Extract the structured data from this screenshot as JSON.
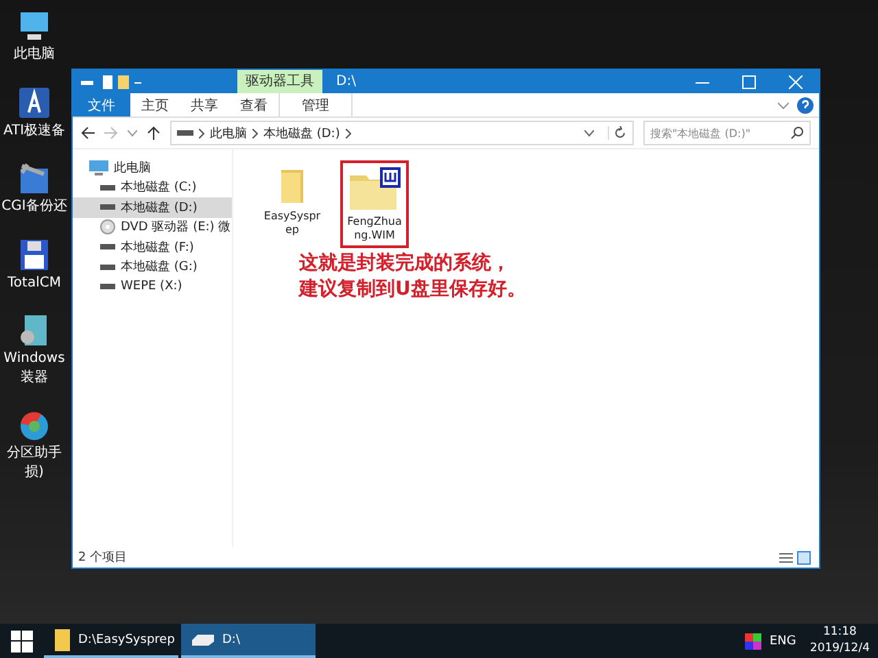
{
  "desktop_icons": [
    {
      "kind": "pc",
      "label": "此电脑"
    },
    {
      "kind": "backup",
      "label": "ATI极速备"
    },
    {
      "kind": "tool",
      "label": "CGI备份还"
    },
    {
      "kind": "floppy",
      "label": "TotalCM"
    },
    {
      "kind": "installer",
      "label": "Windows",
      "label_2": "装器"
    },
    {
      "kind": "partition",
      "label": "分区助手",
      "label_2": "损)"
    }
  ],
  "window": {
    "title": "D:\\",
    "context_tab": "驱动器工具",
    "ribbon_tabs": [
      {
        "label": "文件",
        "kind": "file",
        "selected": false
      },
      {
        "label": "主页",
        "kind": "tab",
        "selected": false
      },
      {
        "label": "共享",
        "kind": "tab",
        "selected": false
      },
      {
        "label": "查看",
        "kind": "tab",
        "selected": false
      },
      {
        "label": "管理",
        "kind": "context",
        "selected": false
      }
    ],
    "breadcrumbs": [
      "此电脑",
      "本地磁盘 (D:)"
    ],
    "search": {
      "placeholder": "搜索\"本地磁盘 (D:)\""
    },
    "sidebar": {
      "items": [
        {
          "label": "此电脑",
          "kind": "pc",
          "selected": false,
          "children": [
            {
              "label": "本地磁盘 (C:)",
              "kind": "drive",
              "selected": false
            },
            {
              "label": "本地磁盘 (D:)",
              "kind": "drive",
              "selected": true
            },
            {
              "label": "DVD 驱动器 (E:) 微",
              "kind": "dvd",
              "selected": false
            },
            {
              "label": "本地磁盘 (F:)",
              "kind": "drive",
              "selected": false
            },
            {
              "label": "本地磁盘 (G:)",
              "kind": "drive",
              "selected": false
            },
            {
              "label": "WEPE (X:)",
              "kind": "drive",
              "selected": false
            }
          ]
        }
      ]
    },
    "files": [
      {
        "name": "EasySysprep",
        "kind": "folder",
        "highlighted": false
      },
      {
        "name": "FengZhuang.WIM",
        "kind": "wim",
        "highlighted": true
      }
    ],
    "annotation": [
      "这就是封装完成的系统，",
      "建议复制到U盘里保存好。"
    ],
    "status_bar": "2 个项目"
  },
  "taskbar": {
    "items": [
      {
        "label": "D:\\EasySysprep",
        "kind": "folder",
        "selected": false
      },
      {
        "label": "D:\\",
        "kind": "drive",
        "selected": true
      }
    ],
    "language": "ENG",
    "time": "11:18",
    "date": "2019/12/4"
  }
}
